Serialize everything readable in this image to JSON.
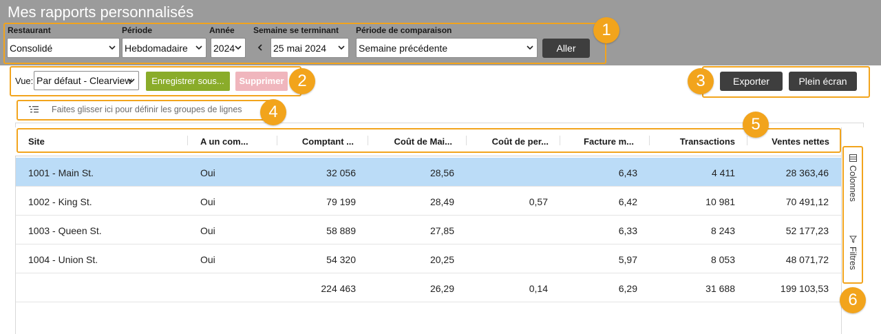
{
  "page_title": "Mes rapports personnalisés",
  "filters": {
    "restaurant": {
      "label": "Restaurant",
      "value": "Consolidé"
    },
    "periode": {
      "label": "Période",
      "value": "Hebdomadaire"
    },
    "annee": {
      "label": "Année",
      "value": "2024"
    },
    "semaine": {
      "label": "Semaine se terminant",
      "value": "25 mai 2024"
    },
    "comparaison": {
      "label": "Période de comparaison",
      "value": "Semaine précédente"
    },
    "go_button": "Aller"
  },
  "toolbar": {
    "view_label": "Vue:",
    "view_value": "Par défaut - Clearview",
    "save_as": "Enregistrer sous...",
    "delete": "Supprimer",
    "export": "Exporter",
    "fullscreen": "Plein écran"
  },
  "grouping_hint": "Faites glisser ici pour définir les groupes de lignes",
  "table": {
    "columns": [
      "Site",
      "A un com...",
      "Comptant ...",
      "Coût de Mai...",
      "Coût de per...",
      "Facture m...",
      "Transactions",
      "Ventes nettes"
    ],
    "rows": [
      [
        "1001 - Main St.",
        "Oui",
        "32 056",
        "28,56",
        "",
        "6,43",
        "4 411",
        "28 363,46"
      ],
      [
        "1002 - King St.",
        "Oui",
        "79 199",
        "28,49",
        "0,57",
        "6,42",
        "10 981",
        "70 491,12"
      ],
      [
        "1003 - Queen St.",
        "Oui",
        "58 889",
        "27,85",
        "",
        "6,33",
        "8 243",
        "52 177,23"
      ],
      [
        "1004 - Union St.",
        "Oui",
        "54 320",
        "20,25",
        "",
        "5,97",
        "8 053",
        "48 071,72"
      ]
    ],
    "totals": [
      "",
      "",
      "224 463",
      "26,29",
      "0,14",
      "6,29",
      "31 688",
      "199 103,53"
    ]
  },
  "side_tabs": {
    "columns": "Colonnes",
    "filters": "Filtres"
  },
  "annotations": [
    "1",
    "2",
    "3",
    "4",
    "5",
    "6"
  ],
  "colors": {
    "accent": "#f2a41c",
    "topbar": "#9b9b9b",
    "selected_row": "#bbdcf7",
    "save_green": "#8aac2a",
    "delete_pink": "#f0b6bd",
    "dark_button": "#3e3e3e"
  },
  "icons": [
    "chevron-down-icon",
    "chevron-left-icon",
    "row-group-icon",
    "columns-icon",
    "filter-icon"
  ]
}
